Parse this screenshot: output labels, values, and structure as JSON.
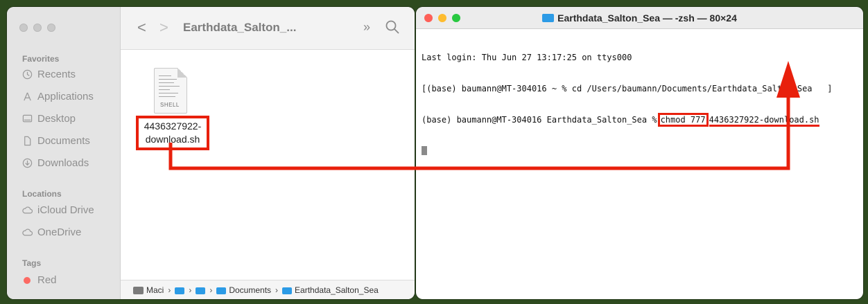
{
  "finder": {
    "title": "Earthdata_Salton_...",
    "nav_back": "<",
    "nav_forward": ">",
    "more": "»",
    "sidebar": {
      "favorites_header": "Favorites",
      "favorites": [
        {
          "label": "Recents",
          "icon": "clock-icon"
        },
        {
          "label": "Applications",
          "icon": "applications-icon"
        },
        {
          "label": "Desktop",
          "icon": "desktop-icon"
        },
        {
          "label": "Documents",
          "icon": "document-icon"
        },
        {
          "label": "Downloads",
          "icon": "download-icon"
        }
      ],
      "locations_header": "Locations",
      "locations": [
        {
          "label": "iCloud Drive",
          "icon": "cloud-icon"
        },
        {
          "label": "OneDrive",
          "icon": "cloud-icon"
        }
      ],
      "tags_header": "Tags",
      "tags": [
        {
          "label": "Red",
          "color": "#fc6a63"
        }
      ]
    },
    "file": {
      "icon_tag": "SHELL",
      "name_line1": "4436327922-",
      "name_line2": "download.sh"
    },
    "pathbar": {
      "drive": "Maci",
      "documents": "Documents",
      "folder": "Earthdata_Salton_Sea",
      "sep": "›"
    }
  },
  "terminal": {
    "title": "Earthdata_Salton_Sea — -zsh — 80×24",
    "line1": "Last login: Thu Jun 27 13:17:25 on ttys000",
    "line2": "[(base) baumann@MT-304016 ~ % cd /Users/baumann/Documents/Earthdata_Salton_Sea   ]",
    "line3_prompt": "(base) baumann@MT-304016 Earthdata_Salton_Sea %",
    "line3_cmd": "chmod 777",
    "line3_file": "4436327922-download.sh"
  },
  "colors": {
    "annotation": "#e8200c",
    "folder_blue": "#2c9be6",
    "background": "#2e4a1f"
  }
}
